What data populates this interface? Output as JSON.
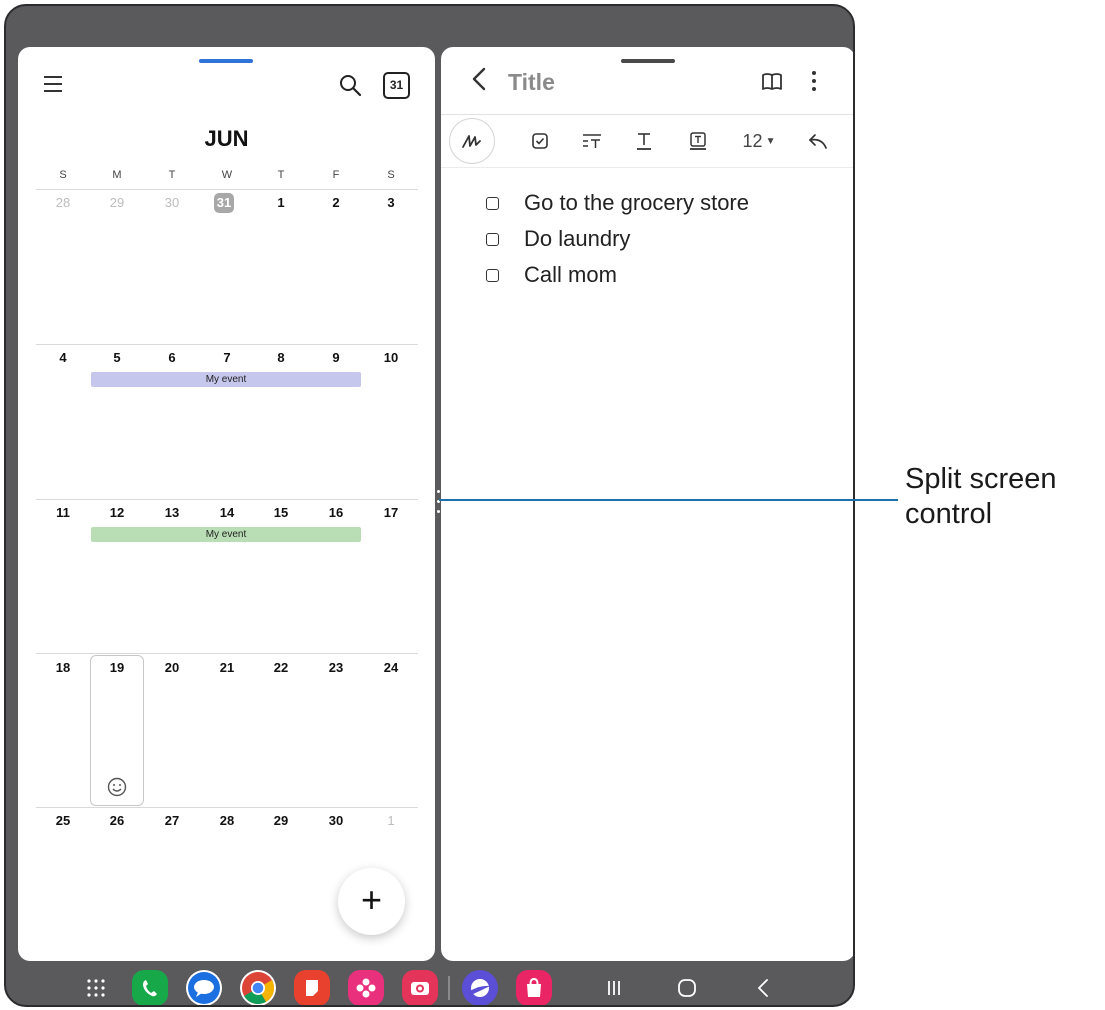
{
  "calendar": {
    "month": "JUN",
    "today_icon_number": "31",
    "weekdays": [
      "S",
      "M",
      "T",
      "W",
      "T",
      "F",
      "S"
    ],
    "weeks": [
      [
        "28",
        "29",
        "30",
        "31",
        "1",
        "2",
        "3"
      ],
      [
        "4",
        "5",
        "6",
        "7",
        "8",
        "9",
        "10"
      ],
      [
        "11",
        "12",
        "13",
        "14",
        "15",
        "16",
        "17"
      ],
      [
        "18",
        "19",
        "20",
        "21",
        "22",
        "23",
        "24"
      ],
      [
        "25",
        "26",
        "27",
        "28",
        "29",
        "30",
        "1"
      ]
    ],
    "events": [
      {
        "label": "My event",
        "color": "#c6c7ec"
      },
      {
        "label": "My event",
        "color": "#b9deb5"
      }
    ],
    "fab_label": "+"
  },
  "notes": {
    "back_glyph": "<",
    "title": "Title",
    "font_size": "12",
    "todos": [
      {
        "text": "Go to the grocery store"
      },
      {
        "text": "Do laundry"
      },
      {
        "text": "Call mom"
      }
    ]
  },
  "callout": {
    "line1": "Split screen",
    "line2": "control",
    "color": "#1f6fa8"
  },
  "taskbar": {
    "apps": [
      "apps-grid-icon",
      "phone-icon",
      "messages-icon",
      "chrome-icon",
      "samsung-notes-icon",
      "gallery-icon",
      "camera-icon",
      "internet-icon",
      "galaxy-store-icon"
    ],
    "nav": [
      "recent-apps-icon",
      "home-icon",
      "back-icon"
    ]
  },
  "colors": {
    "frame": "#5a5a5c",
    "accent_handle": "#2f73d8"
  }
}
